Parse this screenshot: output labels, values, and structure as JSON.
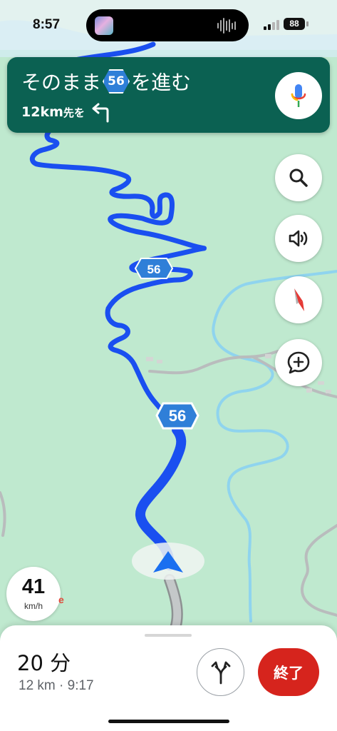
{
  "status_bar": {
    "time": "8:57",
    "battery": "88"
  },
  "banner": {
    "instruction_before": "そのまま",
    "route_number": "56",
    "instruction_after": "を進む",
    "next_distance": "12km",
    "next_suffix": "先を",
    "next_turn_icon": "turn-left-icon",
    "color": "#0b6152"
  },
  "map": {
    "route_shields": [
      "56",
      "56"
    ],
    "route_color": "#1a4ff0",
    "land_color": "#bfe9cf",
    "river_color": "#8fd4ee"
  },
  "buttons": {
    "mic": "mic-icon",
    "search": "search-icon",
    "sound": "volume-icon",
    "compass": "compass-icon",
    "report": "add-report-icon"
  },
  "speed": {
    "value": "41",
    "unit": "km/h"
  },
  "trip": {
    "duration": "20 分",
    "details": "12 km · 9:17",
    "end_label": "終了",
    "end_color": "#d6241d"
  }
}
